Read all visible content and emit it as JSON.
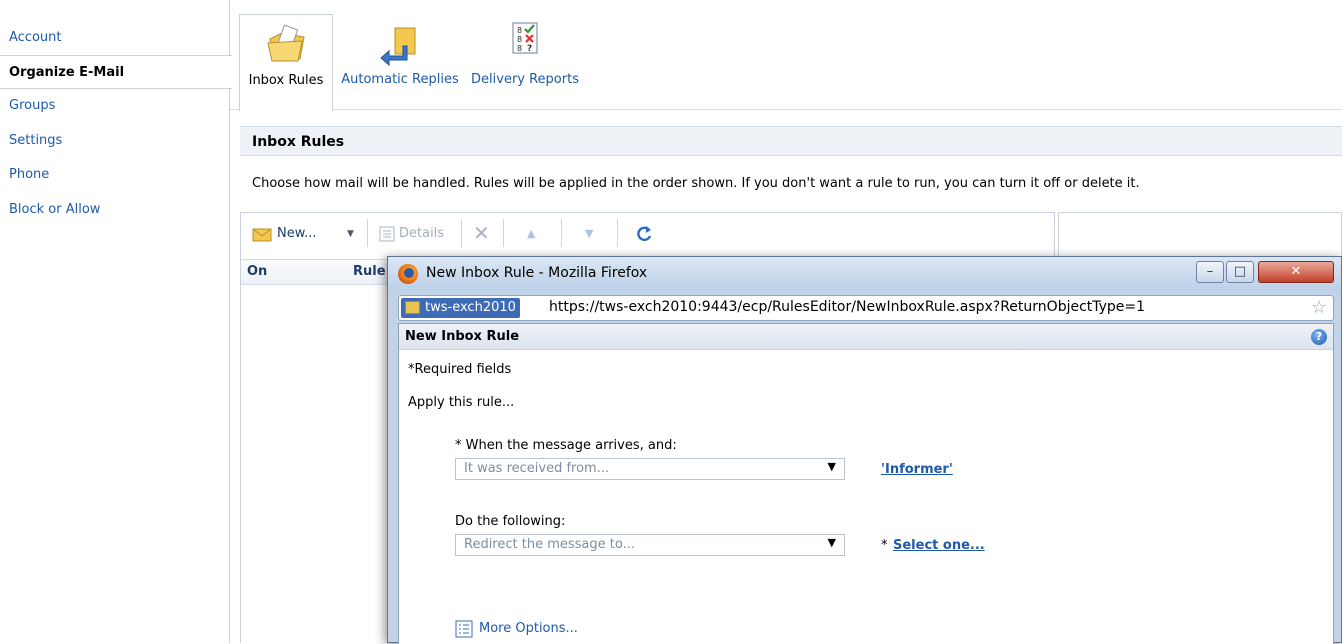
{
  "nav": {
    "items": [
      {
        "label": "Account",
        "active": false
      },
      {
        "label": "Organize E-Mail",
        "active": true
      },
      {
        "label": "Groups",
        "active": false
      },
      {
        "label": "Settings",
        "active": false
      },
      {
        "label": "Phone",
        "active": false
      },
      {
        "label": "Block or Allow",
        "active": false
      }
    ]
  },
  "tabs": [
    {
      "label": "Inbox Rules",
      "icon": "folder-rules-icon",
      "selected": true
    },
    {
      "label": "Automatic Replies",
      "icon": "auto-reply-arrow-icon",
      "selected": false
    },
    {
      "label": "Delivery Reports",
      "icon": "delivery-report-checklist-icon",
      "selected": false
    }
  ],
  "section": {
    "title": "Inbox Rules",
    "description": "Choose how mail will be handled. Rules will be applied in the order shown. If you don't want a rule to run, you can turn it off or delete it."
  },
  "toolbar": {
    "new_label": "New...",
    "details_label": "Details"
  },
  "grid": {
    "columns": [
      "On",
      "Rule"
    ]
  },
  "popup": {
    "window_title": "New Inbox Rule - Mozilla Firefox",
    "site_identity": "tws-exch2010",
    "url": "https://tws-exch2010:9443/ecp/RulesEditor/NewInboxRule.aspx?ReturnObjectType=1",
    "header": "New Inbox Rule",
    "required_note": "*Required fields",
    "apply_label": "Apply this rule...",
    "when_label": "* When the message arrives, and:",
    "when_select": "It was received from...",
    "when_value_link": "'Informer'",
    "do_label": "Do the following:",
    "do_select": "Redirect the message to...",
    "do_required_mark": "*",
    "do_value_link": "Select one...",
    "more_options": "More Options..."
  },
  "colors": {
    "link": "#1f5aa8",
    "border": "#c9d3e0",
    "popup_frame": "#c2d3e8",
    "close_button": "#c4402a"
  }
}
